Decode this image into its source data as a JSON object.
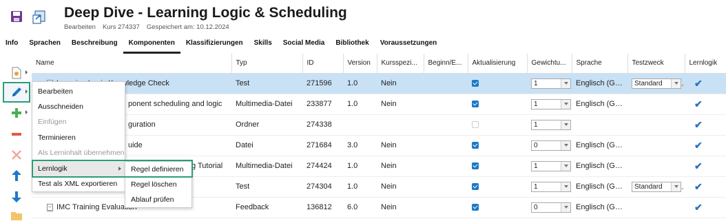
{
  "header": {
    "title": "Deep Dive - Learning Logic & Scheduling",
    "meta_edit": "Bearbeiten",
    "meta_course": "Kurs 274337",
    "meta_saved": "Gespeichert am: 10.12.2024"
  },
  "tabs": [
    "Info",
    "Sprachen",
    "Beschreibung",
    "Komponenten",
    "Klassifizierungen",
    "Skills",
    "Social Media",
    "Bibliothek",
    "Voraussetzungen"
  ],
  "active_tab": "Komponenten",
  "table": {
    "columns": [
      "Name",
      "Typ",
      "ID",
      "Version",
      "Kursspezi...",
      "Beginn/E...",
      "Aktualisierung",
      "Gewichtu...",
      "Sprache",
      "Testzweck",
      "Lernlogik"
    ],
    "rows": [
      {
        "name": "Learning Logic Knowledge Check",
        "typ": "Test",
        "id": "271596",
        "version": "1.0",
        "kurs": "Nein",
        "aktual": true,
        "gewicht": "1",
        "sprache": "Englisch (GB...",
        "testzweck": "Standard",
        "lernlogik": true
      },
      {
        "name": "ponent scheduling and logic",
        "typ": "Multimedia-Datei",
        "id": "233877",
        "version": "1.0",
        "kurs": "Nein",
        "aktual": true,
        "gewicht": "1",
        "sprache": "Englisch (GB...",
        "testzweck": "",
        "lernlogik": true
      },
      {
        "name": "guration",
        "typ": "Ordner",
        "id": "274338",
        "version": "",
        "kurs": "",
        "aktual": false,
        "gewicht": "1",
        "sprache": "",
        "testzweck": "",
        "lernlogik": true
      },
      {
        "name": "uide",
        "typ": "Datei",
        "id": "271684",
        "version": "3.0",
        "kurs": "Nein",
        "aktual": true,
        "gewicht": "0",
        "sprache": "Englisch (GB...",
        "testzweck": "",
        "lernlogik": true
      },
      {
        "name": "g Tutorial",
        "typ": "Multimedia-Datei",
        "id": "274424",
        "version": "1.0",
        "kurs": "Nein",
        "aktual": true,
        "gewicht": "1",
        "sprache": "Englisch (GB...",
        "testzweck": "",
        "lernlogik": true
      },
      {
        "name": "",
        "typ": "Test",
        "id": "274304",
        "version": "1.0",
        "kurs": "Nein",
        "aktual": true,
        "gewicht": "1",
        "sprache": "Englisch (GB...",
        "testzweck": "Standard",
        "lernlogik": true
      },
      {
        "name": "IMC Training Evaluation",
        "typ": "Feedback",
        "id": "136812",
        "version": "6.0",
        "kurs": "Nein",
        "aktual": true,
        "gewicht": "0",
        "sprache": "Englisch (GB...",
        "testzweck": "",
        "lernlogik": true
      }
    ]
  },
  "context_menu": {
    "items": [
      {
        "label": "Bearbeiten",
        "disabled": false
      },
      {
        "label": "Ausschneiden",
        "disabled": false
      },
      {
        "label": "Einfügen",
        "disabled": true
      },
      {
        "label": "Terminieren",
        "disabled": false
      },
      {
        "label": "Als Lerninhalt übernehmen",
        "disabled": true
      },
      {
        "label": "Lernlogik",
        "disabled": false
      },
      {
        "label": "Test als XML exportieren",
        "disabled": false
      }
    ],
    "submenu": [
      "Regel definieren",
      "Regel löschen",
      "Ablauf prüfen"
    ]
  },
  "colors": {
    "accent": "#2a9d78",
    "selection": "#c9e1f5",
    "check": "#1b79c8",
    "add": "#4caf50",
    "remove": "#e05a47",
    "arrow": "#1f78c8"
  }
}
